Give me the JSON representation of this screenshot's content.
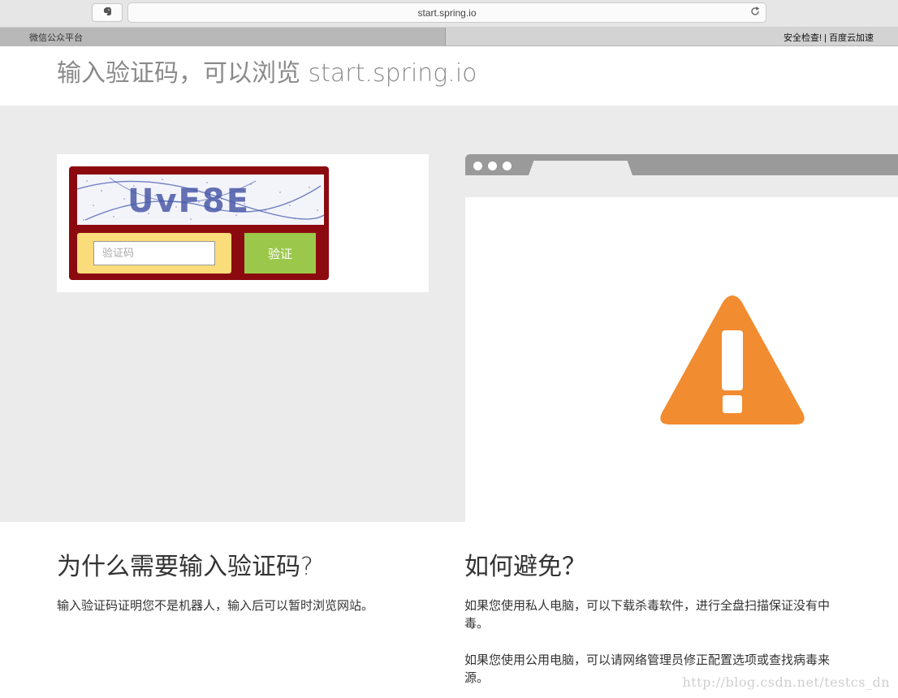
{
  "browser": {
    "url": "start.spring.io",
    "active_tab": "微信公众平台",
    "right_links": "安全检查! | 百度云加速"
  },
  "header": {
    "title": "输入验证码，可以浏览 start.spring.io"
  },
  "captcha": {
    "image_text": "UvF8E",
    "input_placeholder": "验证码",
    "submit_label": "验证"
  },
  "why": {
    "heading": "为什么需要输入验证码?",
    "text": "输入验证码证明您不是机器人，输入后可以暂时浏览网站。"
  },
  "avoid": {
    "heading": "如何避免？",
    "para1": "如果您使用私人电脑，可以下载杀毒软件，进行全盘扫描保证没有中毒。",
    "para2": "如果您使用公用电脑，可以请网络管理员修正配置选项或查找病毒来源。"
  },
  "watermark": "http://blog.csdn.net/testcs_dn",
  "colors": {
    "captcha_frame": "#8b0a10",
    "input_bg": "#fbdc7a",
    "verify_button": "#9bc84a",
    "warning": "#f28c30"
  },
  "icons": {
    "extension": "evernote-elephant-icon",
    "reload": "reload-icon",
    "warning": "warning-triangle-icon"
  }
}
